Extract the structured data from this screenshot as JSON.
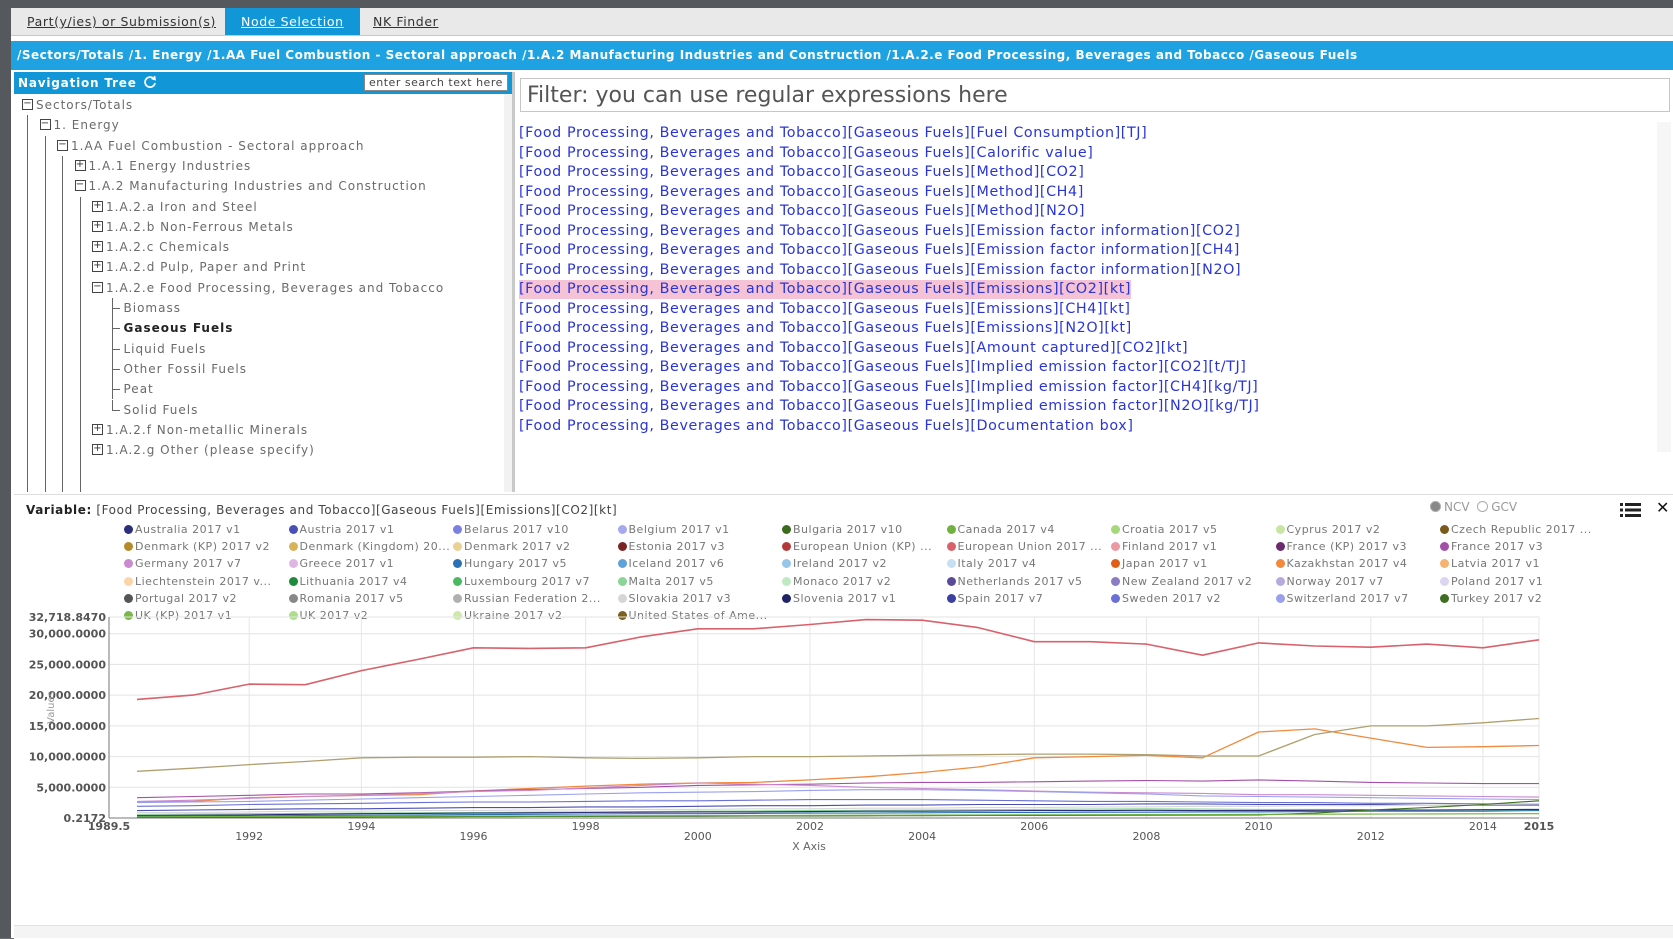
{
  "tabs": [
    {
      "label": "Part(y/ies) or Submission(s)",
      "active": false
    },
    {
      "label": "Node Selection",
      "active": true
    },
    {
      "label": "NK Finder",
      "active": false
    }
  ],
  "breadcrumb": "/Sectors/Totals /1. Energy /1.AA Fuel Combustion - Sectoral approach /1.A.2 Manufacturing Industries and Construction /1.A.2.e Food Processing, Beverages and Tobacco /Gaseous Fuels",
  "navigation": {
    "title": "Navigation Tree",
    "search_placeholder": "enter search text here",
    "tree": [
      {
        "label": "Sectors/Totals",
        "depth": 0,
        "toggle": "minus"
      },
      {
        "label": "1. Energy",
        "depth": 1,
        "toggle": "minus"
      },
      {
        "label": "1.AA Fuel Combustion - Sectoral approach",
        "depth": 2,
        "toggle": "minus"
      },
      {
        "label": "1.A.1 Energy Industries",
        "depth": 3,
        "toggle": "plus"
      },
      {
        "label": "1.A.2 Manufacturing Industries and Construction",
        "depth": 3,
        "toggle": "minus"
      },
      {
        "label": "1.A.2.a Iron and Steel",
        "depth": 4,
        "toggle": "plus"
      },
      {
        "label": "1.A.2.b Non-Ferrous Metals",
        "depth": 4,
        "toggle": "plus"
      },
      {
        "label": "1.A.2.c Chemicals",
        "depth": 4,
        "toggle": "plus"
      },
      {
        "label": "1.A.2.d Pulp, Paper and Print",
        "depth": 4,
        "toggle": "plus"
      },
      {
        "label": "1.A.2.e Food Processing, Beverages and Tobacco",
        "depth": 4,
        "toggle": "minus"
      },
      {
        "label": "Biomass",
        "depth": 5,
        "toggle": "leaf"
      },
      {
        "label": "Gaseous Fuels",
        "depth": 5,
        "toggle": "leaf",
        "selected": true
      },
      {
        "label": "Liquid Fuels",
        "depth": 5,
        "toggle": "leaf"
      },
      {
        "label": "Other Fossil Fuels",
        "depth": 5,
        "toggle": "leaf"
      },
      {
        "label": "Peat",
        "depth": 5,
        "toggle": "leaf"
      },
      {
        "label": "Solid Fuels",
        "depth": 5,
        "toggle": "leaf"
      },
      {
        "label": "1.A.2.f Non-metallic Minerals",
        "depth": 4,
        "toggle": "plus"
      },
      {
        "label": "1.A.2.g Other (please specify)",
        "depth": 4,
        "toggle": "plus"
      }
    ]
  },
  "filter": {
    "placeholder": "Filter: you can use regular expressions here"
  },
  "variables": [
    "[Food Processing, Beverages and Tobacco][Gaseous Fuels][Fuel Consumption][TJ]",
    "[Food Processing, Beverages and Tobacco][Gaseous Fuels][Calorific value]",
    "[Food Processing, Beverages and Tobacco][Gaseous Fuels][Method][CO2]",
    "[Food Processing, Beverages and Tobacco][Gaseous Fuels][Method][CH4]",
    "[Food Processing, Beverages and Tobacco][Gaseous Fuels][Method][N2O]",
    "[Food Processing, Beverages and Tobacco][Gaseous Fuels][Emission factor information][CO2]",
    "[Food Processing, Beverages and Tobacco][Gaseous Fuels][Emission factor information][CH4]",
    "[Food Processing, Beverages and Tobacco][Gaseous Fuels][Emission factor information][N2O]",
    "[Food Processing, Beverages and Tobacco][Gaseous Fuels][Emissions][CO2][kt]",
    "[Food Processing, Beverages and Tobacco][Gaseous Fuels][Emissions][CH4][kt]",
    "[Food Processing, Beverages and Tobacco][Gaseous Fuels][Emissions][N2O][kt]",
    "[Food Processing, Beverages and Tobacco][Gaseous Fuels][Amount captured][CO2][kt]",
    "[Food Processing, Beverages and Tobacco][Gaseous Fuels][Implied emission factor][CO2][t/TJ]",
    "[Food Processing, Beverages and Tobacco][Gaseous Fuels][Implied emission factor][CH4][kg/TJ]",
    "[Food Processing, Beverages and Tobacco][Gaseous Fuels][Implied emission factor][N2O][kg/TJ]",
    "[Food Processing, Beverages and Tobacco][Gaseous Fuels][Documentation box]"
  ],
  "selected_variable_index": 8,
  "chart_panel": {
    "variable_prefix": "Variable:",
    "variable_value": "[Food Processing, Beverages and Tobacco][Gaseous Fuels][Emissions][CO2][kt]",
    "radio_ncv": "NCV",
    "radio_gcv": "GCV",
    "list_icon": "list-icon",
    "close_icon": "close-icon"
  },
  "chart_data": {
    "type": "line",
    "xlabel": "X Axis",
    "ylabel": "Values",
    "xlim": [
      1989.5,
      2015
    ],
    "ylim": [
      0.2172,
      32718.847
    ],
    "y_tick_labels": [
      "32,718.8470",
      "30,000.0000",
      "25,000.0000",
      "20,000.0000",
      "15,000.0000",
      "10,000.0000",
      "5,000.0000",
      "0.2172"
    ],
    "y_tick_values": [
      32718.847,
      30000,
      25000,
      20000,
      15000,
      10000,
      5000,
      0.2172
    ],
    "x_tick_labels": [
      "1989.5",
      "1992",
      "1994",
      "1996",
      "1998",
      "2000",
      "2002",
      "2004",
      "2006",
      "2008",
      "2010",
      "2012",
      "2014",
      "2015"
    ],
    "x_tick_values": [
      1989.5,
      1992,
      1994,
      1996,
      1998,
      2000,
      2002,
      2004,
      2006,
      2008,
      2010,
      2012,
      2014,
      2015
    ],
    "grid": true,
    "legend_position": "top",
    "legend": [
      {
        "name": "Australia 2017 v1",
        "color": "#2b2f7a"
      },
      {
        "name": "Austria 2017 v1",
        "color": "#4a4fb5"
      },
      {
        "name": "Belarus 2017 v10",
        "color": "#7b7fe0"
      },
      {
        "name": "Belgium 2017 v1",
        "color": "#a6a9ee"
      },
      {
        "name": "Bulgaria 2017 v10",
        "color": "#3b6b1f"
      },
      {
        "name": "Canada 2017 v4",
        "color": "#6fb23f"
      },
      {
        "name": "Croatia 2017 v5",
        "color": "#a7d77b"
      },
      {
        "name": "Cyprus 2017 v2",
        "color": "#c9e5a3"
      },
      {
        "name": "Czech Republic 2017 ...",
        "color": "#7a5a1a"
      },
      {
        "name": "Denmark (KP) 2017 v2",
        "color": "#b58a2b"
      },
      {
        "name": "Denmark (Kingdom) 20...",
        "color": "#d8b35a"
      },
      {
        "name": "Denmark 2017 v2",
        "color": "#e9d196"
      },
      {
        "name": "Estonia 2017 v3",
        "color": "#7a2424"
      },
      {
        "name": "European Union (KP) ...",
        "color": "#b33a3a"
      },
      {
        "name": "European Union 2017 ...",
        "color": "#d9616b"
      },
      {
        "name": "Finland 2017 v1",
        "color": "#ea9aa4"
      },
      {
        "name": "France (KP) 2017 v3",
        "color": "#6a2a6e"
      },
      {
        "name": "France 2017 v3",
        "color": "#a34fa8"
      },
      {
        "name": "Germany 2017 v7",
        "color": "#c98ad0"
      },
      {
        "name": "Greece 2017 v1",
        "color": "#dfb6e3"
      },
      {
        "name": "Hungary 2017 v5",
        "color": "#2a71b3"
      },
      {
        "name": "Iceland 2017 v6",
        "color": "#5ea2d8"
      },
      {
        "name": "Ireland 2017 v2",
        "color": "#98c6ea"
      },
      {
        "name": "Italy 2017 v4",
        "color": "#c6dff4"
      },
      {
        "name": "Japan 2017 v1",
        "color": "#e0601a"
      },
      {
        "name": "Kazakhstan 2017 v4",
        "color": "#f08a3e"
      },
      {
        "name": "Latvia 2017 v1",
        "color": "#f7b26f"
      },
      {
        "name": "Liechtenstein 2017 v...",
        "color": "#fbd5a8"
      },
      {
        "name": "Lithuania 2017 v4",
        "color": "#1f8a3a"
      },
      {
        "name": "Luxembourg 2017 v7",
        "color": "#4db863"
      },
      {
        "name": "Malta 2017 v5",
        "color": "#8ad497"
      },
      {
        "name": "Monaco 2017 v2",
        "color": "#bfe8c5"
      },
      {
        "name": "Netherlands 2017 v5",
        "color": "#5b4a99"
      },
      {
        "name": "New Zealand 2017 v2",
        "color": "#8c7cc2"
      },
      {
        "name": "Norway 2017 v7",
        "color": "#b7abde"
      },
      {
        "name": "Poland 2017 v1",
        "color": "#dcd5f0"
      },
      {
        "name": "Portugal 2017 v2",
        "color": "#555555"
      },
      {
        "name": "Romania 2017 v5",
        "color": "#888888"
      },
      {
        "name": "Russian Federation 2...",
        "color": "#b0b0b0"
      },
      {
        "name": "Slovakia 2017 v3",
        "color": "#d6d6d6"
      },
      {
        "name": "Slovenia 2017 v1",
        "color": "#1e2466"
      },
      {
        "name": "Spain 2017 v7",
        "color": "#3a40a0"
      },
      {
        "name": "Sweden 2017 v2",
        "color": "#6a70d6"
      },
      {
        "name": "Switzerland 2017 v7",
        "color": "#9aa0ec"
      },
      {
        "name": "Turkey 2017 v2",
        "color": "#3d6e21"
      },
      {
        "name": "UK (KP) 2017 v1",
        "color": "#79b84a"
      },
      {
        "name": "UK 2017 v2",
        "color": "#aedc87"
      },
      {
        "name": "Ukraine 2017 v2",
        "color": "#cfe8ab"
      },
      {
        "name": "United States of Ame...",
        "color": "#7e5d1e"
      }
    ],
    "x": [
      1990,
      1991,
      1992,
      1993,
      1994,
      1995,
      1996,
      1997,
      1998,
      1999,
      2000,
      2001,
      2002,
      2003,
      2004,
      2005,
      2006,
      2007,
      2008,
      2009,
      2010,
      2011,
      2012,
      2013,
      2014,
      2015
    ],
    "series": [
      {
        "name": "United States of Ame...",
        "color": "#d9616b",
        "width": 1.6,
        "values": [
          19300,
          20000,
          21800,
          21700,
          24000,
          25800,
          27700,
          27600,
          27700,
          29500,
          30800,
          30800,
          31500,
          32300,
          32200,
          31000,
          28700,
          28700,
          28300,
          26500,
          28500,
          28000,
          27800,
          28300,
          27700,
          29000
        ]
      },
      {
        "name": "Japan 2017 v1",
        "color": "#f08a3e",
        "width": 1.3,
        "values": [
          2600,
          2700,
          3300,
          3500,
          3700,
          3800,
          4400,
          4800,
          5200,
          5500,
          5700,
          5800,
          6200,
          6700,
          7400,
          8300,
          9800,
          10000,
          10200,
          9800,
          14000,
          14500,
          13000,
          11500,
          11600,
          11800
        ]
      },
      {
        "name": "Russian Federation 2...",
        "color": "#b0a070",
        "width": 1.3,
        "values": [
          7600,
          8100,
          8700,
          9200,
          9800,
          9900,
          9900,
          10000,
          9800,
          9700,
          9800,
          10000,
          10000,
          10100,
          10200,
          10300,
          10400,
          10400,
          10300,
          10100,
          10100,
          13600,
          15000,
          15000,
          15500,
          16200
        ]
      },
      {
        "name": "France 2017 v3",
        "color": "#a34fa8",
        "width": 1.1,
        "values": [
          3300,
          3500,
          3700,
          3900,
          3900,
          4100,
          4400,
          4600,
          4800,
          5000,
          5300,
          5400,
          5500,
          5700,
          5800,
          5800,
          5900,
          6000,
          6100,
          6000,
          6200,
          6000,
          5800,
          5700,
          5600,
          5600
        ]
      },
      {
        "name": "Germany 2017 v7",
        "color": "#c98ad0",
        "width": 1.1,
        "values": [
          2700,
          2900,
          3200,
          3500,
          3700,
          4000,
          4300,
          4500,
          4900,
          5300,
          5700,
          5500,
          5300,
          5000,
          4800,
          4600,
          4400,
          4200,
          4100,
          4000,
          3800,
          3800,
          3700,
          3600,
          3500,
          3400
        ]
      },
      {
        "name": "Italy 2017 v4",
        "color": "#9aa0ec",
        "width": 1.1,
        "values": [
          2500,
          2600,
          2700,
          2900,
          3100,
          3300,
          3500,
          3700,
          3900,
          4100,
          4200,
          4300,
          4500,
          4600,
          4600,
          4500,
          4300,
          4100,
          3900,
          3600,
          3500,
          3400,
          3300,
          3200,
          3100,
          3000
        ]
      },
      {
        "name": "European Union 2017 ...",
        "color": "#6a70d6",
        "width": 1.1,
        "values": [
          1900,
          2000,
          2200,
          2300,
          2400,
          2500,
          2600,
          2600,
          2700,
          2800,
          2800,
          2900,
          3000,
          3000,
          3000,
          2900,
          2800,
          2700,
          2700,
          2600,
          2500,
          2500,
          2400,
          2400,
          2300,
          2300
        ]
      },
      {
        "name": "Netherlands 2017 v5",
        "color": "#4a4fb5",
        "width": 1.1,
        "values": [
          1200,
          1300,
          1400,
          1500,
          1500,
          1600,
          1700,
          1700,
          1800,
          1800,
          1900,
          2000,
          2000,
          2100,
          2100,
          2200,
          2200,
          2200,
          2300,
          2300,
          2200,
          2200,
          2200,
          2100,
          2100,
          2100
        ]
      },
      {
        "name": "Poland 2017 v1",
        "color": "#d6d6d6",
        "width": 1.1,
        "values": [
          900,
          900,
          1000,
          1100,
          1100,
          1200,
          1200,
          1300,
          1300,
          1400,
          1400,
          1500,
          1500,
          1600,
          1600,
          1700,
          1700,
          1800,
          1800,
          1900,
          1900,
          2000,
          2000,
          2100,
          2200,
          2300
        ]
      },
      {
        "name": "Sweden 2017 v2",
        "color": "#8ad497",
        "width": 1.1,
        "values": [
          600,
          650,
          700,
          750,
          800,
          850,
          900,
          950,
          1000,
          1050,
          1100,
          1150,
          1200,
          1250,
          1300,
          1350,
          1400,
          1450,
          1500,
          1450,
          1400,
          1400,
          1350,
          1300,
          1300,
          1300
        ]
      },
      {
        "name": "Ukraine 2017 v2",
        "color": "#2b2f7a",
        "width": 1.1,
        "values": [
          400,
          450,
          500,
          600,
          700,
          750,
          800,
          850,
          900,
          950,
          1000,
          1000,
          1050,
          1100,
          1100,
          1150,
          1200,
          1200,
          1250,
          1200,
          1200,
          1250,
          1300,
          1300,
          1350,
          1400
        ]
      },
      {
        "name": "Hungary 2017 v5",
        "color": "#2a71b3",
        "width": 1.1,
        "values": [
          300,
          300,
          350,
          400,
          450,
          500,
          550,
          600,
          650,
          700,
          700,
          750,
          800,
          800,
          850,
          900,
          900,
          950,
          950,
          1000,
          1000,
          1050,
          1100,
          1100,
          1100,
          1200
        ]
      },
      {
        "name": "Turkey 2017 v2",
        "color": "#3d6e21",
        "width": 1.1,
        "values": [
          100,
          120,
          140,
          160,
          180,
          200,
          220,
          240,
          260,
          280,
          300,
          320,
          340,
          360,
          380,
          400,
          420,
          440,
          460,
          480,
          500,
          800,
          1300,
          1700,
          2200,
          2800
        ]
      },
      {
        "name": "Canada 2017 v4",
        "color": "#6fb23f",
        "width": 1.1,
        "values": [
          200,
          220,
          240,
          260,
          280,
          300,
          320,
          340,
          360,
          380,
          400,
          420,
          440,
          460,
          480,
          500,
          520,
          540,
          560,
          580,
          600,
          620,
          640,
          660,
          680,
          700
        ]
      }
    ]
  }
}
